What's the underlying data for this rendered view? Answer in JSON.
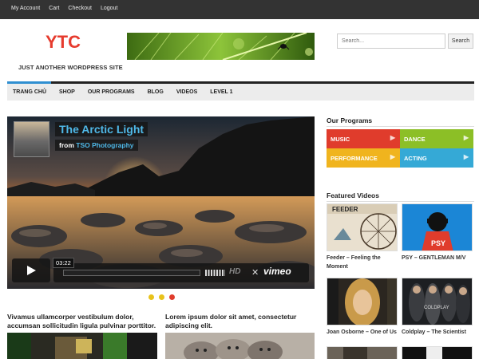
{
  "topbar": {
    "links": [
      "My Account",
      "Cart",
      "Checkout",
      "Logout"
    ]
  },
  "header": {
    "logo": "YTC",
    "tagline": "JUST ANOTHER WORDPRESS SITE",
    "search": {
      "placeholder": "Search...",
      "button": "Search"
    }
  },
  "nav": {
    "items": [
      "TRANG CHỦ",
      "SHOP",
      "OUR PROGRAMS",
      "BLOG",
      "VIDEOS",
      "LEVEL 1"
    ]
  },
  "video": {
    "title": "The Arctic Light",
    "from_prefix": "from",
    "from_name": "TSO Photography",
    "time": "03:22",
    "hd_label": "HD",
    "brand": "vimeo"
  },
  "slider": {
    "dot_colors": [
      "#e8c21a",
      "#e8c21a",
      "#e03c2c"
    ]
  },
  "posts": [
    {
      "title": "Vivamus ullamcorper vestibulum dolor, accumsan sollicitudin ligula pulvinar porttitor."
    },
    {
      "title": "Lorem ipsum dolor sit amet, consectetur adipiscing elit."
    }
  ],
  "sidebar": {
    "programs_heading": "Our Programs",
    "programs": [
      {
        "label": "MUSIC",
        "color": "#e03c2c"
      },
      {
        "label": "DANCE",
        "color": "#8cbf26"
      },
      {
        "label": "PERFORMANCE",
        "color": "#f0b41e"
      },
      {
        "label": "ACTING",
        "color": "#35a9d6"
      }
    ],
    "videos_heading": "Featured Videos",
    "videos": [
      {
        "caption": "Feeder – Feeling the Moment",
        "thumb_text": "FEEDER"
      },
      {
        "caption": "PSY – GENTLEMAN M/V",
        "thumb_text": "PSY"
      },
      {
        "caption": "Joan Osborne – One of Us",
        "thumb_text": ""
      },
      {
        "caption": "Coldplay – The Scientist",
        "thumb_text": "COLDPLAY"
      }
    ]
  },
  "colors": {
    "accent_red": "#e63b2e",
    "link_blue": "#4fb8e8",
    "nav_accent": "#2f8fd1"
  }
}
